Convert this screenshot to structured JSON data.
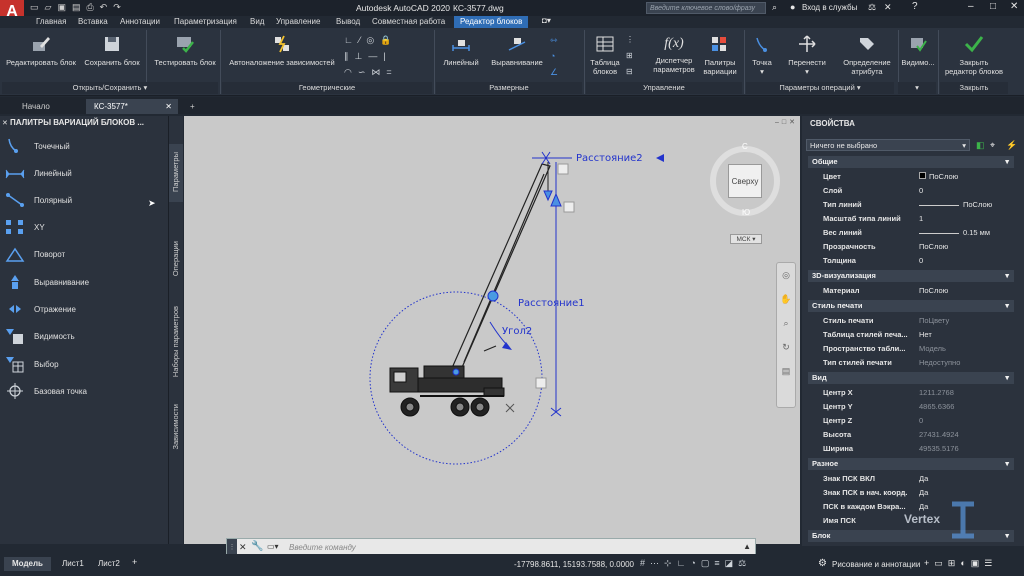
{
  "app": {
    "logo": "A",
    "title": "Autodesk AutoCAD 2020",
    "file": "КС-3577.dwg",
    "search_placeholder": "Введите ключевое слово/фразу",
    "signin": "Вход в службы",
    "colors": {
      "accent": "#2f6db5",
      "blue_param": "#1a3ccc",
      "logo_red": "#c6322c"
    }
  },
  "menu": {
    "tabs": [
      "Главная",
      "Вставка",
      "Аннотации",
      "Параметризация",
      "Вид",
      "Управление",
      "Вывод",
      "Совместная работа",
      "Редактор блоков"
    ],
    "active_index": 8
  },
  "ribbon": {
    "buttons": {
      "edit_block": "Редактировать блок",
      "save_block": "Сохранить блок",
      "test_block": "Тестировать блок",
      "auto_constraints": "Автоналожение зависимостей",
      "linear": "Линейный",
      "align": "Выравнивание",
      "block_table_1": "Таблица",
      "block_table_2": "блоков",
      "param_manager_1": "Диспетчер",
      "param_manager_2": "параметров",
      "var_palettes_1": "Палитры",
      "var_palettes_2": "вариации",
      "point": "Точка",
      "move": "Перенести",
      "attr_def_1": "Определение",
      "attr_def_2": "атрибута",
      "visibility": "Видимо...",
      "close_editor_1": "Закрыть",
      "close_editor_2": "редактор блоков"
    },
    "panels": {
      "open_save": "Открыть/Сохранить",
      "geometric": "Геометрические",
      "dimensional": "Размерные",
      "manage": "Управление",
      "action_params": "Параметры операций",
      "close": "Закрыть"
    }
  },
  "file_tabs": [
    "Начало",
    "КС-3577*"
  ],
  "palette": {
    "title": "ПАЛИТРЫ ВАРИАЦИЙ БЛОКОВ ...",
    "items": [
      "Точечный",
      "Линейный",
      "Полярный",
      "XY",
      "Поворот",
      "Выравнивание",
      "Отражение",
      "Видимость",
      "Выбор",
      "Базовая точка"
    ],
    "side_tabs": [
      "Параметры",
      "Операции",
      "Наборы параметров",
      "Зависимости"
    ]
  },
  "canvas": {
    "labels": {
      "dist2": "Расстояние2",
      "dist1": "Расстояние1",
      "angle2": "Угол2"
    },
    "viewcube": {
      "top": "Сверху",
      "n": "С",
      "s": "Ю",
      "ucs": "МСК"
    }
  },
  "properties": {
    "title": "СВОЙСТВА",
    "selector": "Ничего не выбрано",
    "sections": [
      {
        "name": "Общие",
        "rows": [
          {
            "k": "Цвет",
            "v": "ПоСлою",
            "swatch": true
          },
          {
            "k": "Слой",
            "v": "0"
          },
          {
            "k": "Тип линий",
            "v": "ПоСлою",
            "line": true
          },
          {
            "k": "Масштаб типа линий",
            "v": "1"
          },
          {
            "k": "Вес линий",
            "v": "0.15 мм",
            "line": true
          },
          {
            "k": "Прозрачность",
            "v": "ПоСлою"
          },
          {
            "k": "Толщина",
            "v": "0"
          }
        ]
      },
      {
        "name": "3D-визуализация",
        "rows": [
          {
            "k": "Материал",
            "v": "ПоСлою"
          }
        ]
      },
      {
        "name": "Стиль печати",
        "rows": [
          {
            "k": "Стиль печати",
            "v": "ПоЦвету",
            "dim": true
          },
          {
            "k": "Таблица стилей печа...",
            "v": "Нет"
          },
          {
            "k": "Пространство табли...",
            "v": "Модель",
            "dim": true
          },
          {
            "k": "Тип стилей печати",
            "v": "Недоступно",
            "dim": true
          }
        ]
      },
      {
        "name": "Вид",
        "rows": [
          {
            "k": "Центр X",
            "v": "1211.2768",
            "dim": true
          },
          {
            "k": "Центр Y",
            "v": "4865.6366",
            "dim": true
          },
          {
            "k": "Центр Z",
            "v": "0",
            "dim": true
          },
          {
            "k": "Высота",
            "v": "27431.4924",
            "dim": true
          },
          {
            "k": "Ширина",
            "v": "49535.5176",
            "dim": true
          }
        ]
      },
      {
        "name": "Разное",
        "rows": [
          {
            "k": "Знак ПСК ВКЛ",
            "v": "Да"
          },
          {
            "k": "Знак ПСК в нач. коорд.",
            "v": "Да"
          },
          {
            "k": "ПСК в каждом Вэкра...",
            "v": "Да"
          },
          {
            "k": "Имя ПСК",
            "v": ""
          }
        ]
      },
      {
        "name": "Блок",
        "rows": []
      }
    ]
  },
  "command": {
    "placeholder": "Введите команду"
  },
  "status": {
    "tabs": [
      "Модель",
      "Лист1",
      "Лист2"
    ],
    "coords": "-17798.8611, 15193.7588, 0.0000",
    "workspace": "Рисование и аннотации"
  },
  "watermark": "Vertex"
}
